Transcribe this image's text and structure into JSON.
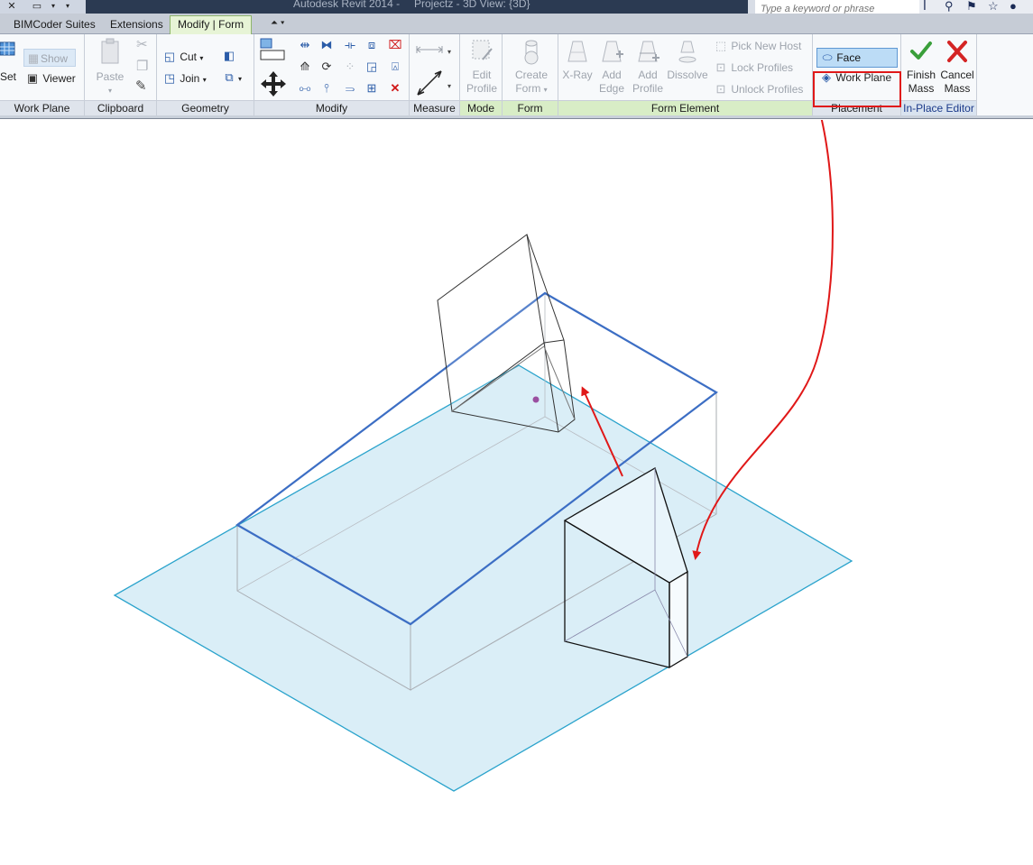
{
  "titlebar": {
    "title": "Autodesk Revit 2014 -",
    "project": "Projectz - 3D View: {3D}",
    "search_placeholder": "Type a keyword or phrase"
  },
  "tabs": [
    {
      "label": "BIMCoder Suites"
    },
    {
      "label": "Extensions"
    },
    {
      "label": "Modify | Form"
    }
  ],
  "ribbon": {
    "workplane": {
      "label": "Work Plane",
      "set": "Set",
      "show": "Show",
      "viewer": "Viewer"
    },
    "clipboard": {
      "label": "Clipboard",
      "paste": "Paste"
    },
    "geometry": {
      "label": "Geometry",
      "cut": "Cut",
      "join": "Join"
    },
    "modify": {
      "label": "Modify"
    },
    "measure": {
      "label": "Measure"
    },
    "mode": {
      "label": "Mode",
      "edit_profile_1": "Edit",
      "edit_profile_2": "Profile"
    },
    "form": {
      "label": "Form",
      "create_form_1": "Create",
      "create_form_2": "Form"
    },
    "form_element": {
      "label": "Form Element",
      "xray": "X-Ray",
      "add_edge_1": "Add",
      "add_edge_2": "Edge",
      "add_profile_1": "Add",
      "add_profile_2": "Profile",
      "dissolve": "Dissolve",
      "pick_new_host": "Pick  New Host",
      "lock_profiles": "Lock  Profiles",
      "unlock_profiles": "Unlock  Profiles"
    },
    "placement": {
      "label": "Placement",
      "face": "Face",
      "work_plane": "Work Plane"
    },
    "inplace": {
      "label": "In-Place Editor",
      "finish_1": "Finish",
      "finish_2": "Mass",
      "cancel_1": "Cancel",
      "cancel_2": "Mass"
    }
  },
  "colors": {
    "accent_tab": "#e7f4d6",
    "highlight_red": "#e01818",
    "ground_fill": "#daeef7",
    "ground_stroke": "#2aa3cc",
    "box_top": "#3c6ec4"
  }
}
